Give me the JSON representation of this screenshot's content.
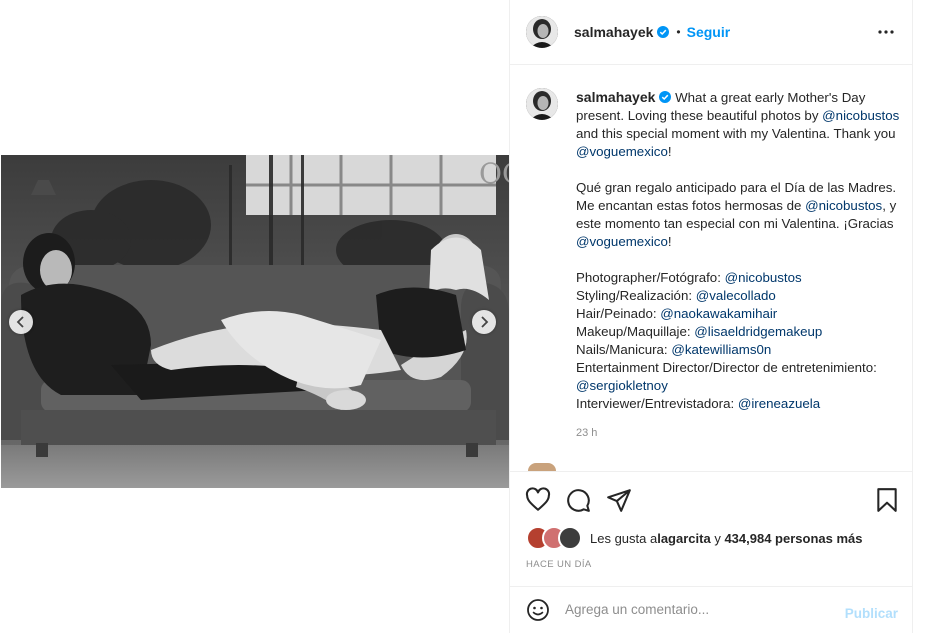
{
  "post": {
    "username": "salmahayek",
    "separator": "•",
    "follow_label": "Seguir",
    "more_icon": "more-horizontal-icon",
    "verified_color": "#0095f6"
  },
  "caption": {
    "intro": " What a great early Mother's Day present. Loving these beautiful photos by ",
    "m1": "@nicobustos",
    "t1": " and this special moment with my Valentina. Thank you ",
    "m2": "@voguemexico",
    "t2": "!",
    "es1": "Qué gran regalo anticipado para el Día de las Madres. Me encantan estas fotos hermosas de ",
    "m3": "@nicobustos",
    "es2": ", y este momento tan especial con mi Valentina. ¡Gracias ",
    "m4": "@voguemexico",
    "es3": "!",
    "credits": [
      {
        "label": "Photographer/Fotógrafo: ",
        "mention": "@nicobustos"
      },
      {
        "label": "Styling/Realización: ",
        "mention": "@valecollado"
      },
      {
        "label": "Hair/Peinado: ",
        "mention": "@naokawakamihair"
      },
      {
        "label": "Makeup/Maquillaje: ",
        "mention": "@lisaeldridgemakeup"
      },
      {
        "label": "Nails/Manicura: ",
        "mention": "@katewilliams0n"
      },
      {
        "label": "Entertainment Director/Director de entretenimiento: ",
        "mention": "@sergiokletnoy"
      },
      {
        "label": "Interviewer/Entrevistadora: ",
        "mention": "@ireneazuela"
      }
    ],
    "time": "23 h"
  },
  "actions": {
    "like_icon": "heart-icon",
    "comment_icon": "comment-icon",
    "share_icon": "share-icon",
    "save_icon": "bookmark-icon"
  },
  "likes": {
    "prefix": "Les gusta a ",
    "user": "lagarcita",
    "middle": " y ",
    "count": "434,984 personas más"
  },
  "date": "HACE UN DÍA",
  "comment": {
    "placeholder": "Agrega un comentario...",
    "publish_label": "Publicar",
    "emoji_icon": "emoji-icon"
  }
}
